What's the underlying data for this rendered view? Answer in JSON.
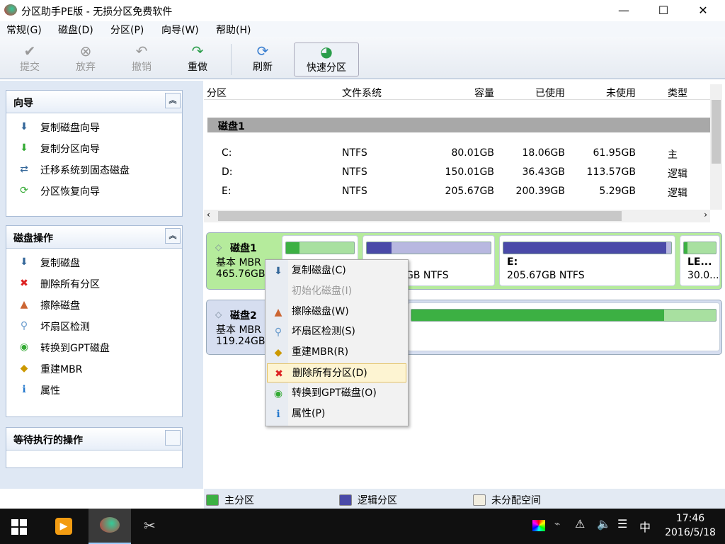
{
  "window": {
    "title": "分区助手PE版 - 无损分区免费软件",
    "minimize": "—",
    "maximize": "☐",
    "close": "✕"
  },
  "menu": [
    "常规(G)",
    "磁盘(D)",
    "分区(P)",
    "向导(W)",
    "帮助(H)"
  ],
  "toolbar": [
    {
      "label": "提交",
      "icon": "✔",
      "enabled": false
    },
    {
      "label": "放弃",
      "icon": "⊗",
      "enabled": false
    },
    {
      "label": "撤销",
      "icon": "↶",
      "enabled": false
    },
    {
      "label": "重做",
      "icon": "↷",
      "enabled": true
    },
    {
      "label": "刷新",
      "icon": "⟳",
      "enabled": true
    },
    {
      "label": "快速分区",
      "icon": "◕",
      "enabled": true
    }
  ],
  "wizard": {
    "title": "向导",
    "items": [
      "复制磁盘向导",
      "复制分区向导",
      "迁移系统到固态磁盘",
      "分区恢复向导"
    ]
  },
  "disk_ops": {
    "title": "磁盘操作",
    "items": [
      "复制磁盘",
      "删除所有分区",
      "擦除磁盘",
      "坏扇区检测",
      "转换到GPT磁盘",
      "重建MBR",
      "属性"
    ]
  },
  "pending": {
    "title": "等待执行的操作"
  },
  "table": {
    "headers": [
      "分区",
      "文件系统",
      "容量",
      "已使用",
      "未使用",
      "类型"
    ],
    "group": "磁盘1",
    "rows": [
      [
        "C:",
        "NTFS",
        "80.01GB",
        "18.06GB",
        "61.95GB",
        "主"
      ],
      [
        "D:",
        "NTFS",
        "150.01GB",
        "36.43GB",
        "113.57GB",
        "逻辑"
      ],
      [
        "E:",
        "NTFS",
        "205.67GB",
        "200.39GB",
        "5.29GB",
        "逻辑"
      ]
    ]
  },
  "disks": [
    {
      "name": "磁盘1",
      "type": "基本 MBR",
      "size": "465.76GB",
      "parts": [
        {
          "used": 0.2,
          "kind": "primary"
        },
        {
          "label": "",
          "info": "GB NTFS",
          "used": 0.2,
          "kind": "logical"
        },
        {
          "label": "E:",
          "info": "205.67GB NTFS",
          "used": 0.97,
          "kind": "logical"
        },
        {
          "label": "LE...",
          "info": "30.0...",
          "used": 0.1,
          "kind": "primary"
        }
      ]
    },
    {
      "name": "磁盘2",
      "type": "基本 MBR",
      "size": "119.24GB",
      "parts": [
        {
          "used": 0.83,
          "kind": "primary"
        }
      ]
    }
  ],
  "context_menu": [
    {
      "label": "复制磁盘(C)",
      "icon": "⬇"
    },
    {
      "label": "初始化磁盘(I)",
      "disabled": true
    },
    {
      "label": "擦除磁盘(W)",
      "icon": "▲"
    },
    {
      "label": "坏扇区检测(S)",
      "icon": "⚲"
    },
    {
      "label": "重建MBR(R)",
      "icon": "◆"
    },
    {
      "label": "删除所有分区(D)",
      "icon": "✖",
      "highlighted": true
    },
    {
      "label": "转换到GPT磁盘(O)",
      "icon": "◉"
    },
    {
      "label": "属性(P)",
      "icon": "ℹ"
    }
  ],
  "legend": [
    "主分区",
    "逻辑分区",
    "未分配空间"
  ],
  "colors": {
    "primary": "#3cb043",
    "logical": "#4a4aa8",
    "unallocated": "#f2eee0"
  },
  "taskbar": {
    "time": "17:46",
    "date": "2016/5/18",
    "ime": "中"
  }
}
